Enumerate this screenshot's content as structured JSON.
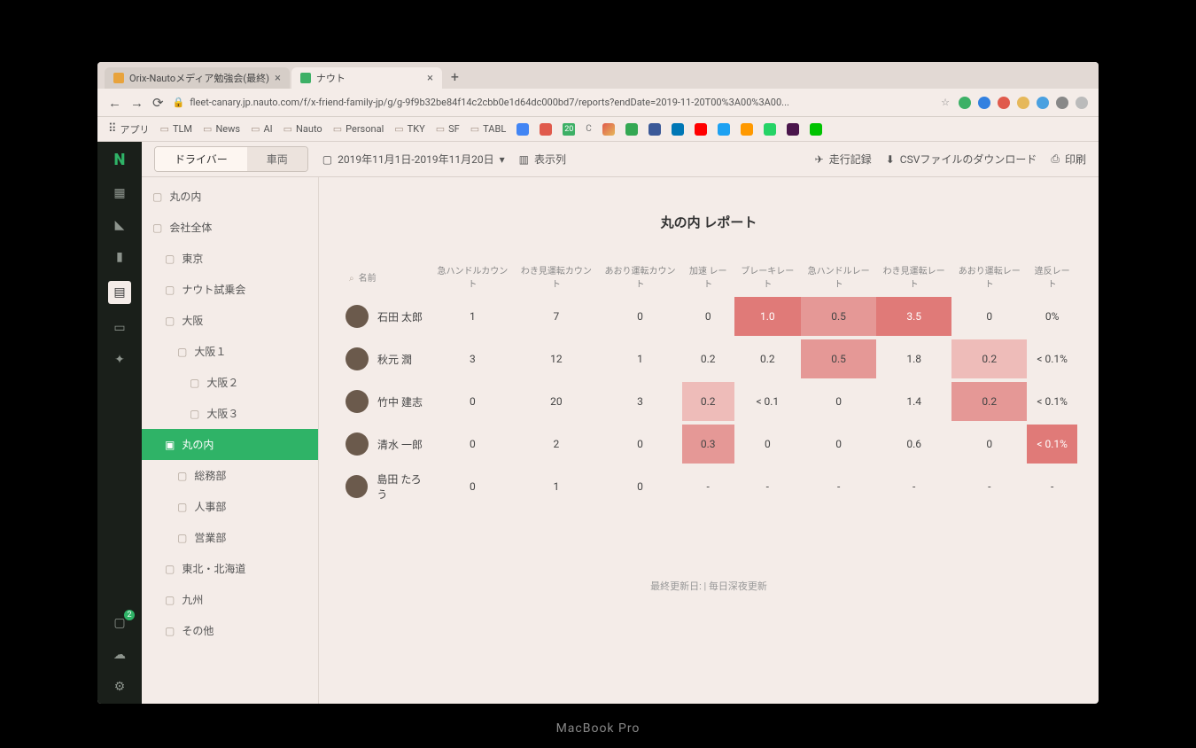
{
  "browser": {
    "tabs": [
      {
        "title": "Orix-Nautoメディア勉強会(最終)"
      },
      {
        "title": "ナウト"
      }
    ],
    "url": "fleet-canary.jp.nauto.com/f/x-friend-family-jp/g/g-9f9b32be84f14c2cbb0e1d64dc000bd7/reports?endDate=2019-11-20T00%3A00%3A00...",
    "bookmarks_label": "アプリ",
    "bookmarks": [
      "TLM",
      "News",
      "AI",
      "Nauto",
      "Personal",
      "TKY",
      "SF",
      "TABL"
    ]
  },
  "toolbar": {
    "seg_driver": "ドライバー",
    "seg_vehicle": "車両",
    "date_range": "2019年11月1日-2019年11月20日",
    "columns": "表示列",
    "trip_log": "走行記録",
    "csv": "CSVファイルのダウンロード",
    "print": "印刷"
  },
  "tree": {
    "root": "丸の内",
    "items": [
      {
        "label": "会社全体",
        "indent": 0
      },
      {
        "label": "東京",
        "indent": 1
      },
      {
        "label": "ナウト試乗会",
        "indent": 1
      },
      {
        "label": "大阪",
        "indent": 1
      },
      {
        "label": "大阪１",
        "indent": 2
      },
      {
        "label": "大阪２",
        "indent": 3
      },
      {
        "label": "大阪３",
        "indent": 3
      },
      {
        "label": "丸の内",
        "indent": 1,
        "selected": true
      },
      {
        "label": "総務部",
        "indent": 2
      },
      {
        "label": "人事部",
        "indent": 2
      },
      {
        "label": "営業部",
        "indent": 2
      },
      {
        "label": "東北・北海道",
        "indent": 1
      },
      {
        "label": "九州",
        "indent": 1
      },
      {
        "label": "その他",
        "indent": 1
      }
    ]
  },
  "report": {
    "title": "丸の内 レポート",
    "name_header": "名前",
    "columns": [
      "急ハンドルカウント",
      "わき見運転カウント",
      "あおり運転カウント",
      "加速 レート",
      "ブレーキレート",
      "急ハンドルレート",
      "わき見運転レート",
      "あおり運転レート",
      "違反レート"
    ],
    "rows": [
      {
        "name": "石田 太郎",
        "v": [
          "1",
          "7",
          "0",
          "0",
          {
            "t": "1.0",
            "h": 3
          },
          {
            "t": "0.5",
            "h": 2
          },
          {
            "t": "3.5",
            "h": 3
          },
          "0",
          "0%"
        ]
      },
      {
        "name": "秋元 潤",
        "v": [
          "3",
          "12",
          "1",
          "0.2",
          "0.2",
          {
            "t": "0.5",
            "h": 2
          },
          "1.8",
          {
            "t": "0.2",
            "h": 1
          },
          "< 0.1%"
        ]
      },
      {
        "name": "竹中 建志",
        "v": [
          "0",
          "20",
          "3",
          {
            "t": "0.2",
            "h": 1
          },
          "< 0.1",
          "0",
          "1.4",
          {
            "t": "0.2",
            "h": 2
          },
          "< 0.1%"
        ]
      },
      {
        "name": "清水 一郎",
        "v": [
          "0",
          "2",
          "0",
          {
            "t": "0.3",
            "h": 2
          },
          "0",
          "0",
          "0.6",
          "0",
          {
            "t": "< 0.1%",
            "h": 3
          }
        ]
      },
      {
        "name": "島田 たろう",
        "v": [
          "0",
          "1",
          "0",
          "-",
          "-",
          "-",
          "-",
          "-",
          "-"
        ]
      }
    ],
    "footer": "最終更新日: | 毎日深夜更新"
  },
  "laptop_label": "MacBook Pro"
}
